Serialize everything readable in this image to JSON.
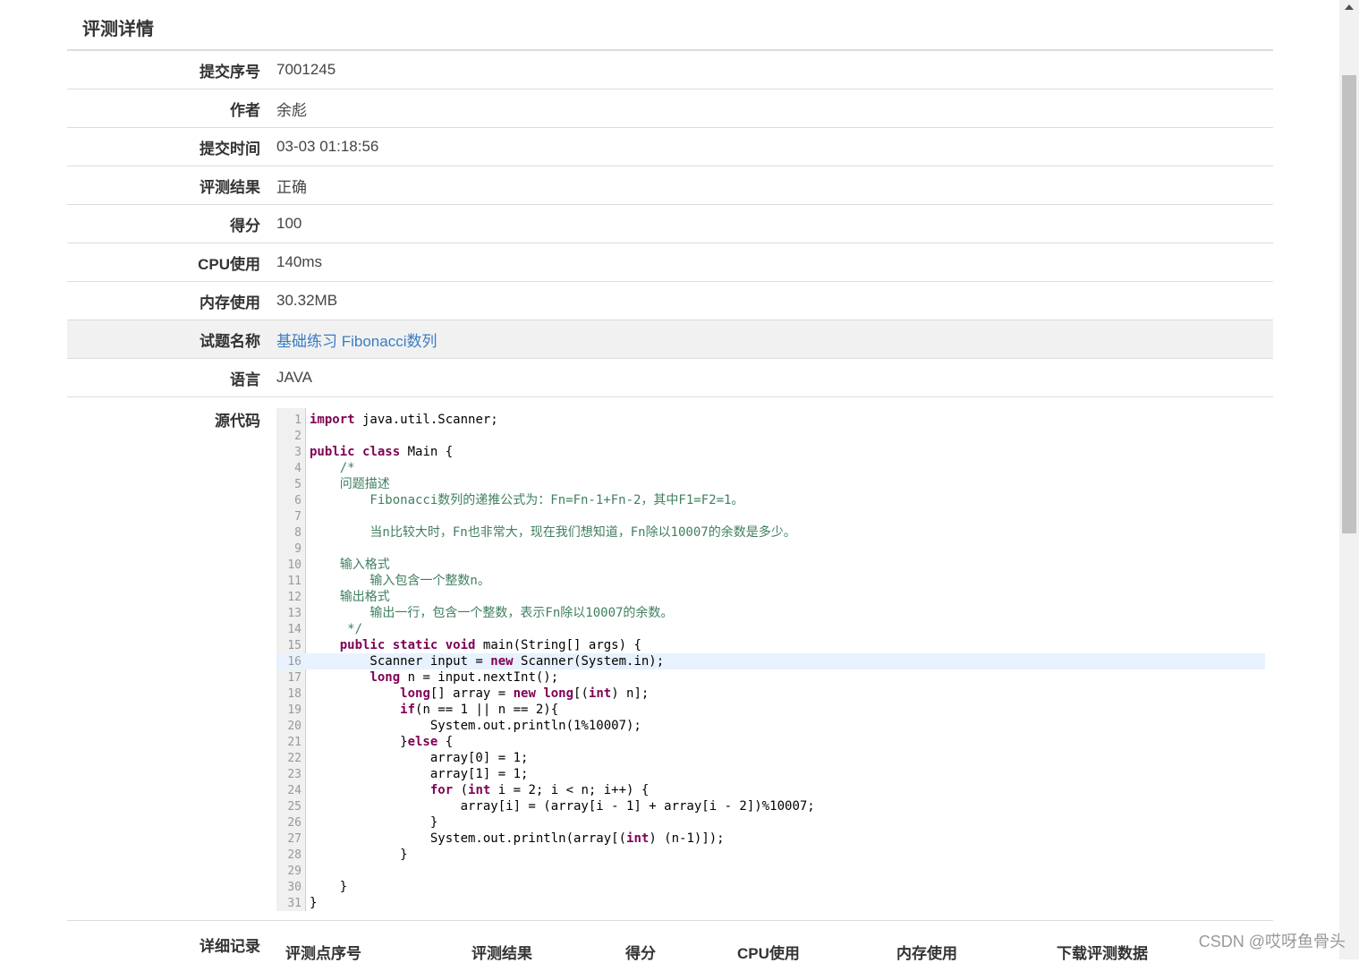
{
  "panel": {
    "title": "评测详情"
  },
  "rows": [
    {
      "key": "submit-id",
      "label": "提交序号",
      "value": "7001245"
    },
    {
      "key": "author",
      "label": "作者",
      "value": "余彪"
    },
    {
      "key": "submit-time",
      "label": "提交时间",
      "value": "03-03 01:18:56"
    },
    {
      "key": "result",
      "label": "评测结果",
      "value": "正确"
    },
    {
      "key": "score",
      "label": "得分",
      "value": "100"
    },
    {
      "key": "cpu",
      "label": "CPU使用",
      "value": "140ms"
    },
    {
      "key": "memory",
      "label": "内存使用",
      "value": "30.32MB"
    },
    {
      "key": "problem",
      "label": "试题名称",
      "value": "基础练习 Fibonacci数列"
    },
    {
      "key": "language",
      "label": "语言",
      "value": "JAVA"
    }
  ],
  "source": {
    "label": "源代码",
    "highlight_line": 16,
    "lines": [
      [
        {
          "t": "import",
          "c": "kw"
        },
        {
          "t": " java.util.Scanner;"
        }
      ],
      [],
      [
        {
          "t": "public",
          "c": "kw"
        },
        {
          "t": " "
        },
        {
          "t": "class",
          "c": "kw"
        },
        {
          "t": " Main {"
        }
      ],
      [
        {
          "t": "    /*",
          "c": "cm"
        }
      ],
      [
        {
          "t": "    问题描述",
          "c": "cm"
        }
      ],
      [
        {
          "t": "        Fibonacci数列的递推公式为：Fn=Fn-1+Fn-2，其中F1=F2=1。",
          "c": "cm"
        }
      ],
      [],
      [
        {
          "t": "        当n比较大时，Fn也非常大，现在我们想知道，Fn除以10007的余数是多少。",
          "c": "cm"
        }
      ],
      [],
      [
        {
          "t": "    输入格式",
          "c": "cm"
        }
      ],
      [
        {
          "t": "        输入包含一个整数n。",
          "c": "cm"
        }
      ],
      [
        {
          "t": "    输出格式",
          "c": "cm"
        }
      ],
      [
        {
          "t": "        输出一行，包含一个整数，表示Fn除以10007的余数。",
          "c": "cm"
        }
      ],
      [
        {
          "t": "     */",
          "c": "cm"
        }
      ],
      [
        {
          "t": "    "
        },
        {
          "t": "public",
          "c": "kw"
        },
        {
          "t": " "
        },
        {
          "t": "static",
          "c": "kw"
        },
        {
          "t": " "
        },
        {
          "t": "void",
          "c": "kw"
        },
        {
          "t": " main(String[] args) {"
        }
      ],
      [
        {
          "t": "        Scanner input = "
        },
        {
          "t": "new",
          "c": "kw"
        },
        {
          "t": " Scanner(System.in);"
        }
      ],
      [
        {
          "t": "        "
        },
        {
          "t": "long",
          "c": "kw"
        },
        {
          "t": " n = input.nextInt();"
        }
      ],
      [
        {
          "t": "            "
        },
        {
          "t": "long",
          "c": "kw"
        },
        {
          "t": "[] array = "
        },
        {
          "t": "new",
          "c": "kw"
        },
        {
          "t": " "
        },
        {
          "t": "long",
          "c": "kw"
        },
        {
          "t": "[("
        },
        {
          "t": "int",
          "c": "kw"
        },
        {
          "t": ") n];"
        }
      ],
      [
        {
          "t": "            "
        },
        {
          "t": "if",
          "c": "kw"
        },
        {
          "t": "(n == 1 || n == 2){"
        }
      ],
      [
        {
          "t": "                System.out.println(1%10007);"
        }
      ],
      [
        {
          "t": "            }"
        },
        {
          "t": "else",
          "c": "kw"
        },
        {
          "t": " {"
        }
      ],
      [
        {
          "t": "                array[0] = 1;"
        }
      ],
      [
        {
          "t": "                array[1] = 1;"
        }
      ],
      [
        {
          "t": "                "
        },
        {
          "t": "for",
          "c": "kw"
        },
        {
          "t": " ("
        },
        {
          "t": "int",
          "c": "kw"
        },
        {
          "t": " i = 2; i < n; i++) {"
        }
      ],
      [
        {
          "t": "                    array[i] = (array[i - 1] + array[i - 2])%10007;"
        }
      ],
      [
        {
          "t": "                }"
        }
      ],
      [
        {
          "t": "                System.out.println(array[("
        },
        {
          "t": "int",
          "c": "kw"
        },
        {
          "t": ") (n-1)]);"
        }
      ],
      [
        {
          "t": "            }"
        }
      ],
      [],
      [
        {
          "t": "    }"
        }
      ],
      [
        {
          "t": "}"
        }
      ]
    ]
  },
  "details": {
    "label": "详细记录",
    "columns": [
      "评测点序号",
      "评测结果",
      "得分",
      "CPU使用",
      "内存使用",
      "下载评测数据"
    ]
  },
  "watermark": "CSDN @哎呀鱼骨头"
}
